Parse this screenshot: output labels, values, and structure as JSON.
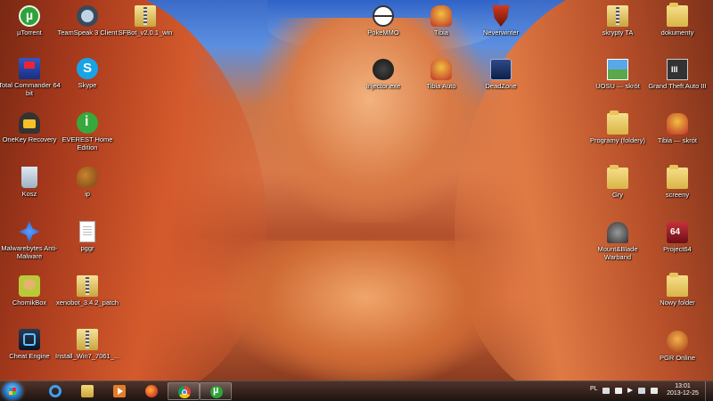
{
  "desktop": {
    "icons": [
      {
        "label": "µTorrent",
        "icon": "utorrent-icon"
      },
      {
        "label": "TeamSpeak 3 Client",
        "icon": "teamspeak-icon"
      },
      {
        "label": "SFBot_v2.0.1_win",
        "icon": "zip-folder-icon"
      },
      {
        "label": "Total Commander 64 bit",
        "icon": "total-commander-icon"
      },
      {
        "label": "Skype",
        "icon": "skype-icon"
      },
      {
        "label": "OneKey Recovery",
        "icon": "onekey-recovery-icon"
      },
      {
        "label": "EVEREST Home Edition",
        "icon": "everest-icon"
      },
      {
        "label": "Kosz",
        "icon": "recycle-bin-icon"
      },
      {
        "label": "ip",
        "icon": "squirrel-icon"
      },
      {
        "label": "Malwarebytes Anti-Malware",
        "icon": "malwarebytes-icon"
      },
      {
        "label": "pggr",
        "icon": "text-file-icon"
      },
      {
        "label": "ChomikBox",
        "icon": "chomikbox-icon"
      },
      {
        "label": "xenobot_3.4.2_patch",
        "icon": "zip-folder-icon"
      },
      {
        "label": "Cheat Engine",
        "icon": "cheat-engine-icon"
      },
      {
        "label": "Install_Win7_7061_...",
        "icon": "zip-folder-icon"
      },
      {
        "label": "PokeMMO",
        "icon": "pokemmo-icon"
      },
      {
        "label": "Tibia",
        "icon": "tibia-icon"
      },
      {
        "label": "Neverwinter",
        "icon": "neverwinter-icon"
      },
      {
        "label": "Injector.exe",
        "icon": "injector-icon"
      },
      {
        "label": "Tibia Auto",
        "icon": "tibia-auto-icon"
      },
      {
        "label": "DeadZone",
        "icon": "deadzone-icon"
      },
      {
        "label": "skrypty TA",
        "icon": "zip-folder-icon"
      },
      {
        "label": "dokumenty",
        "icon": "folder-icon"
      },
      {
        "label": "UOSU — skrót",
        "icon": "uosu-shortcut-icon"
      },
      {
        "label": "Grand Theft Auto III",
        "icon": "gta3-icon"
      },
      {
        "label": "Programy (foldery)",
        "icon": "folder-icon"
      },
      {
        "label": "Tibia — skrót",
        "icon": "tibia-shortcut-icon"
      },
      {
        "label": "Gry",
        "icon": "folder-icon"
      },
      {
        "label": "screeny",
        "icon": "folder-icon"
      },
      {
        "label": "Mount&Blade Warband",
        "icon": "mount-blade-icon"
      },
      {
        "label": "Project64",
        "icon": "project64-icon"
      },
      {
        "label": "Nowy folder",
        "icon": "folder-icon"
      },
      {
        "label": "PGR Online",
        "icon": "pgr-online-icon"
      }
    ]
  },
  "taskbar": {
    "start_icon": "windows-start-icon",
    "pinned": [
      {
        "name": "internet-explorer",
        "icon": "internet-explorer-icon"
      },
      {
        "name": "windows-explorer",
        "icon": "folder-icon"
      },
      {
        "name": "media-player",
        "icon": "media-player-icon"
      },
      {
        "name": "firefox",
        "icon": "firefox-icon"
      },
      {
        "name": "chrome",
        "icon": "chrome-icon",
        "active": true
      },
      {
        "name": "utorrent",
        "icon": "utorrent-icon",
        "active": true
      }
    ],
    "tray": {
      "language": "PL",
      "time": "13:01",
      "date": "2013-12-25"
    }
  }
}
